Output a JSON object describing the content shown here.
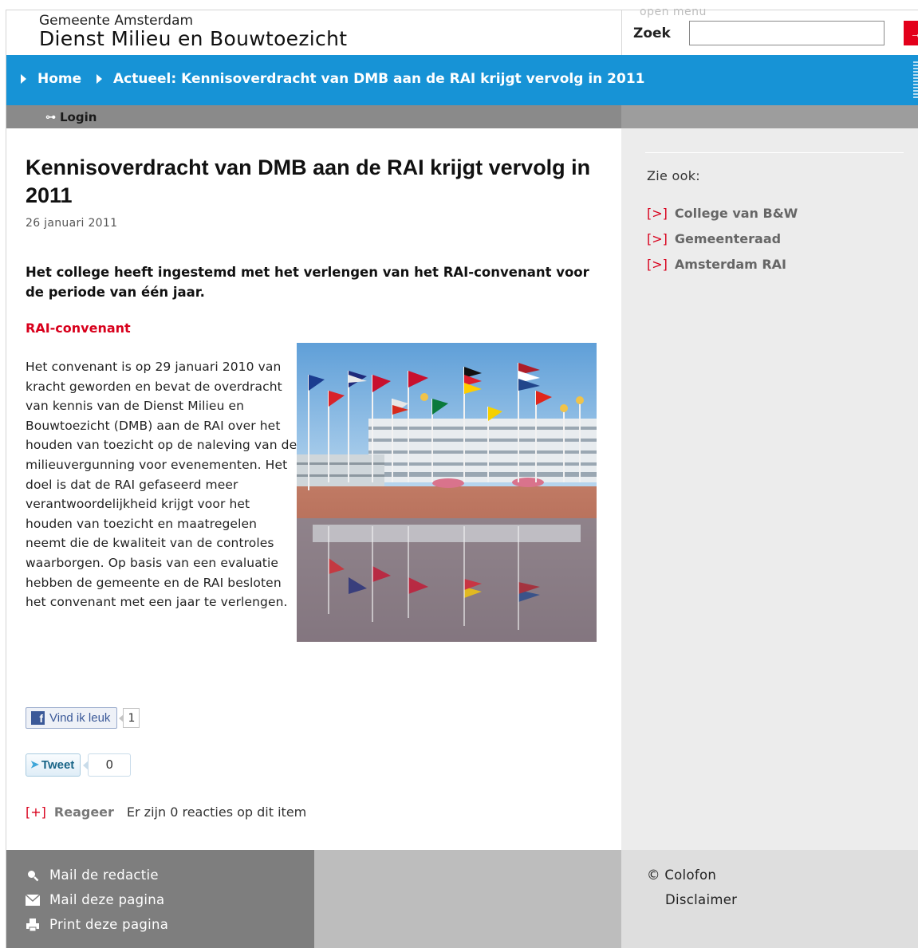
{
  "header": {
    "org_small": "Gemeente Amsterdam",
    "org_big": "Dienst Milieu en Bouwtoezicht",
    "search_label": "Zoek",
    "search_value": "",
    "search_button": "→"
  },
  "breadcrumb": {
    "home": "Home",
    "current": "Actueel: Kennisoverdracht van DMB aan de RAI krijgt vervolg in 2011"
  },
  "subbar": {
    "login": "Login",
    "open_menu": "open menu"
  },
  "article": {
    "title": "Kennisoverdracht van DMB aan de RAI krijgt vervolg in 2011",
    "date": "26 januari 2011",
    "lead": "Het college heeft ingestemd met het verlengen van het RAI-convenant voor de periode van één jaar.",
    "subheading": "RAI-convenant",
    "body": "Het convenant is op 29 januari 2010 van kracht geworden en bevat de overdracht van kennis van de Dienst Milieu en Bouwtoezicht (DMB) aan de RAI over het houden van toezicht op de naleving van de milieuvergunning voor evenementen. Het doel is dat de RAI gefaseerd meer verantwoordelijkheid krijgt voor het houden van toezicht en maatregelen neemt die de kwaliteit van de controles waarborgen. Op basis van een evaluatie hebben de gemeente en de RAI besloten het convenant met een jaar te verlengen."
  },
  "social": {
    "like_label": "Vind ik leuk",
    "like_count": "1",
    "tweet_label": "Tweet",
    "tweet_count": "0"
  },
  "comments": {
    "bracket": "[+]",
    "link": "Reageer",
    "note": "Er zijn 0 reacties op dit item"
  },
  "sidebar": {
    "heading": "Zie ook:",
    "bracket": "[>]",
    "links": [
      {
        "label": "College van B&W"
      },
      {
        "label": "Gemeenteraad"
      },
      {
        "label": "Amsterdam RAI"
      }
    ]
  },
  "footer": {
    "left": [
      {
        "label": "Mail de redactie",
        "icon": "search-icon"
      },
      {
        "label": "Mail deze pagina",
        "icon": "envelope-icon"
      },
      {
        "label": "Print deze pagina",
        "icon": "printer-icon"
      }
    ],
    "right": {
      "colofon": "© Colofon",
      "disclaimer": "Disclaimer"
    }
  },
  "colors": {
    "accent_blue": "#1793d6",
    "accent_red": "#d8001c",
    "sidebar_bg": "#ececec",
    "footer_dark": "#7e7e7e"
  }
}
